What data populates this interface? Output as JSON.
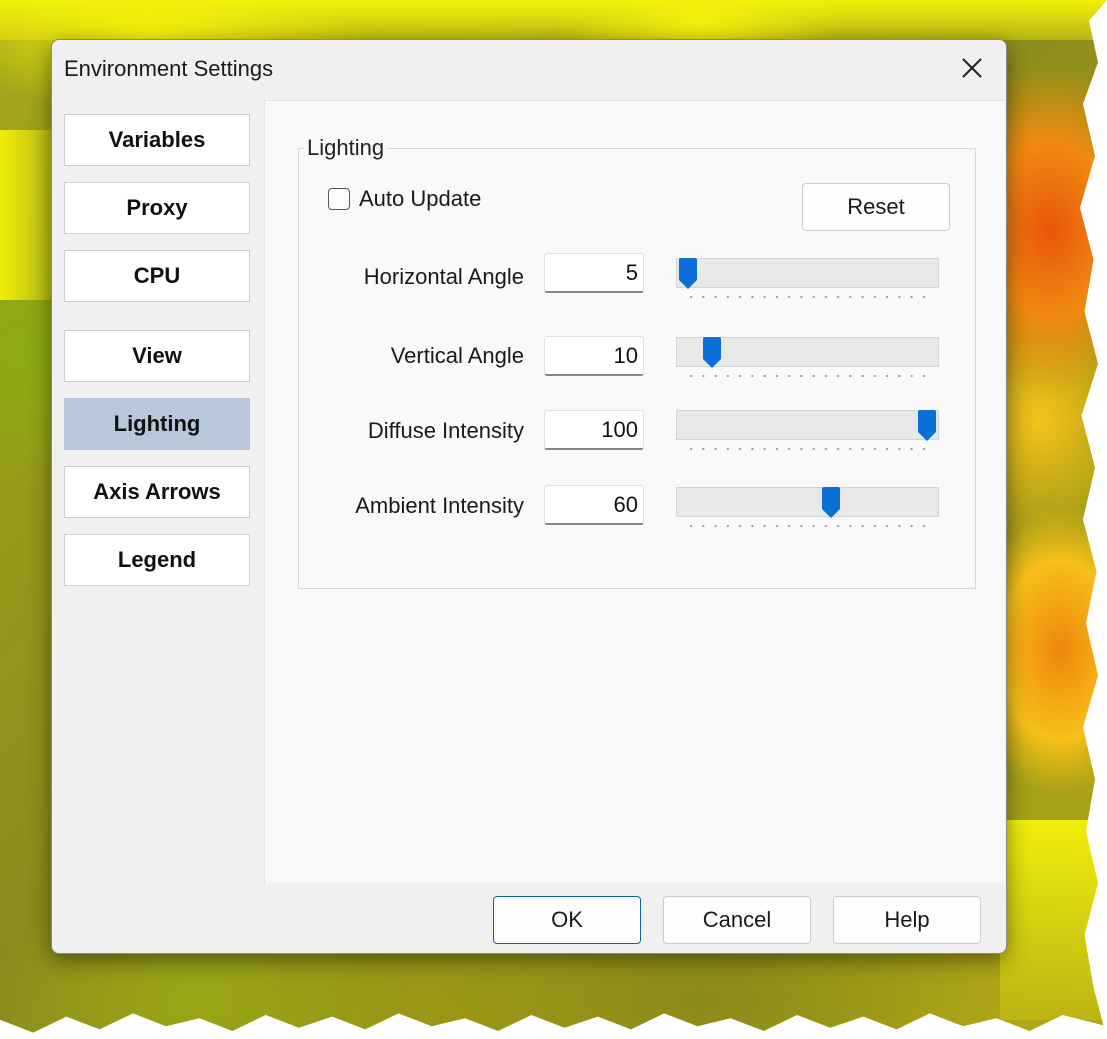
{
  "window": {
    "title": "Environment Settings",
    "close_icon": "close-icon"
  },
  "sidebar": {
    "items": [
      {
        "label": "Variables",
        "active": false
      },
      {
        "label": "Proxy",
        "active": false
      },
      {
        "label": "CPU",
        "active": false
      },
      {
        "label": "View",
        "active": false
      },
      {
        "label": "Lighting",
        "active": true
      },
      {
        "label": "Axis Arrows",
        "active": false
      },
      {
        "label": "Legend",
        "active": false
      }
    ]
  },
  "lighting": {
    "group_label": "Lighting",
    "auto_update": {
      "label": "Auto Update",
      "checked": false
    },
    "reset_label": "Reset",
    "params": [
      {
        "label": "Horizontal Angle",
        "value": "5",
        "slider_fraction": 0.0
      },
      {
        "label": "Vertical Angle",
        "value": "10",
        "slider_fraction": 0.1
      },
      {
        "label": "Diffuse Intensity",
        "value": "100",
        "slider_fraction": 1.0
      },
      {
        "label": "Ambient Intensity",
        "value": "60",
        "slider_fraction": 0.6
      }
    ]
  },
  "footer": {
    "ok_label": "OK",
    "cancel_label": "Cancel",
    "help_label": "Help"
  },
  "colors": {
    "accent": "#0a6fd6",
    "active_nav": "#b8c7da"
  }
}
